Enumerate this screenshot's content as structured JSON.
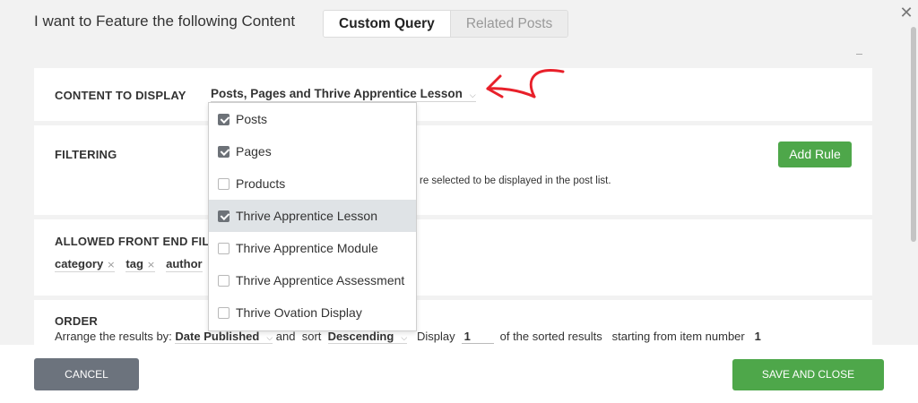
{
  "header": {
    "title": "I want to Feature the following Content",
    "tabs": [
      {
        "label": "Custom Query",
        "active": true
      },
      {
        "label": "Related Posts",
        "active": false
      }
    ],
    "close_icon": "close-icon"
  },
  "content_to_display": {
    "label": "CONTENT TO DISPLAY",
    "selected_value": "Posts, Pages and Thrive Apprentice Lesson",
    "options": [
      {
        "label": "Posts",
        "checked": true
      },
      {
        "label": "Pages",
        "checked": true
      },
      {
        "label": "Products",
        "checked": false
      },
      {
        "label": "Thrive Apprentice Lesson",
        "checked": true
      },
      {
        "label": "Thrive Apprentice Module",
        "checked": false
      },
      {
        "label": "Thrive Apprentice Assessment",
        "checked": false
      },
      {
        "label": "Thrive Ovation Display",
        "checked": false
      }
    ]
  },
  "filtering": {
    "label": "FILTERING",
    "add_rule_label": "Add Rule",
    "description": "re selected to be displayed in the post list."
  },
  "front_end_filters": {
    "label": "ALLOWED FRONT END FILT",
    "tags": [
      "category",
      "tag",
      "author"
    ]
  },
  "order": {
    "label": "ORDER",
    "arrange_prefix": "Arrange the results by:",
    "arrange_value": "Date Published",
    "and_sort": "and  sort",
    "sort_value": "Descending",
    "display_label": "Display",
    "display_value": "1",
    "sorted_results": "of the sorted results",
    "starting_from": "starting from item number",
    "start_value": "1"
  },
  "footer": {
    "cancel_label": "CANCEL",
    "save_label": "SAVE AND CLOSE"
  },
  "colors": {
    "accent_green": "#4ea74a",
    "cancel_gray": "#6c737d",
    "annotation_arrow": "#e8202a"
  }
}
